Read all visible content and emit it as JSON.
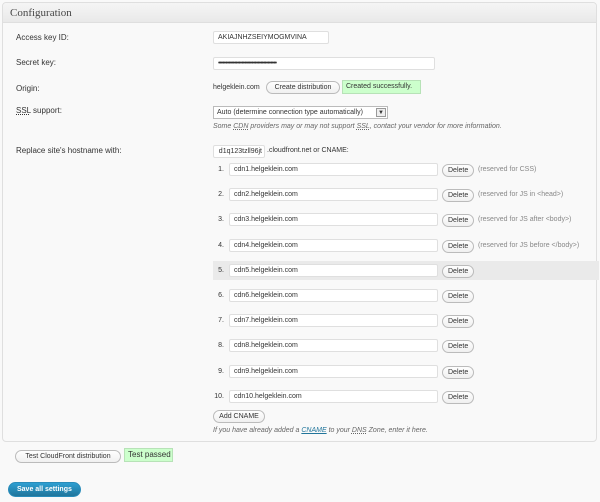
{
  "panel": {
    "title": "Configuration"
  },
  "labels": {
    "access_key": "Access key ID:",
    "secret_key": "Secret key:",
    "origin": "Origin:",
    "ssl_pre": "SSL",
    "ssl_post": " support:",
    "replace": "Replace site's hostname with:"
  },
  "access_key_value": "AKIAJNHZSEIYMOGMVINA",
  "secret_key_value": "••••••••••••••••••••••••••••••••••••••••",
  "origin": {
    "host": "helgeklein.com",
    "create_button": "Create distribution",
    "status": "Created successfully."
  },
  "ssl": {
    "selected": "Auto (determine connection type automatically)",
    "hint_a": "Some ",
    "hint_cdn": "CDN",
    "hint_b": " providers may or may not support ",
    "hint_ssl": "SSL",
    "hint_c": ", contact your vendor for more information."
  },
  "hostname": {
    "value": "d1q123tzll96jt",
    "suffix": ".cloudfront.net or CNAME:"
  },
  "cnames": [
    {
      "num": "1.",
      "value": "cdn1.helgeklein.com",
      "delete": "Delete",
      "note": "(reserved for CSS)"
    },
    {
      "num": "2.",
      "value": "cdn2.helgeklein.com",
      "delete": "Delete",
      "note": "(reserved for JS in <head>)"
    },
    {
      "num": "3.",
      "value": "cdn3.helgeklein.com",
      "delete": "Delete",
      "note": "(reserved for JS after <body>)"
    },
    {
      "num": "4.",
      "value": "cdn4.helgeklein.com",
      "delete": "Delete",
      "note": "(reserved for JS before </body>)"
    },
    {
      "num": "5.",
      "value": "cdn5.helgeklein.com",
      "delete": "Delete",
      "note": ""
    },
    {
      "num": "6.",
      "value": "cdn6.helgeklein.com",
      "delete": "Delete",
      "note": ""
    },
    {
      "num": "7.",
      "value": "cdn7.helgeklein.com",
      "delete": "Delete",
      "note": ""
    },
    {
      "num": "8.",
      "value": "cdn8.helgeklein.com",
      "delete": "Delete",
      "note": ""
    },
    {
      "num": "9.",
      "value": "cdn9.helgeklein.com",
      "delete": "Delete",
      "note": ""
    },
    {
      "num": "10.",
      "value": "cdn10.helgeklein.com",
      "delete": "Delete",
      "note": ""
    }
  ],
  "add_cname": "Add CNAME",
  "cname_hint": {
    "a": "If you have already added a ",
    "link": "CNAME",
    "b": " to your ",
    "dns": "DNS",
    "c": " Zone, enter it here."
  },
  "test": {
    "button": "Test CloudFront distribution",
    "status": "Test passed"
  },
  "save_button": "Save all settings",
  "colors": {
    "success_bg": "#ccffcc",
    "primary": "#21759b",
    "link": "#21759b"
  }
}
